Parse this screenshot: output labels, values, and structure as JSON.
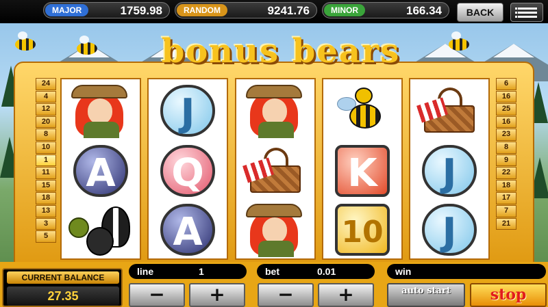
{
  "jackpots": {
    "major": {
      "label": "MAJOR",
      "value": "1759.98",
      "color": "#2f6fd6"
    },
    "random": {
      "label": "RANDOM",
      "value": "9241.76",
      "color": "#d8941a"
    },
    "minor": {
      "label": "MINOR",
      "value": "166.34",
      "color": "#3aa43a"
    }
  },
  "nav": {
    "back_label": "BACK",
    "menu_icon": "menu-icon"
  },
  "title": "bonus bears",
  "paylines": {
    "left": [
      "24",
      "4",
      "12",
      "20",
      "8",
      "10",
      "1",
      "11",
      "15",
      "18",
      "13",
      "3",
      "5"
    ],
    "right": [
      "6",
      "16",
      "25",
      "16",
      "23",
      "8",
      "9",
      "22",
      "18",
      "17",
      "7",
      "21"
    ]
  },
  "reels": [
    [
      "ranger",
      "A",
      "skunk"
    ],
    [
      "J",
      "Q",
      "A"
    ],
    [
      "ranger",
      "picnic-basket",
      "ranger"
    ],
    [
      "wasp",
      "K",
      "10"
    ],
    [
      "picnic-basket",
      "J",
      "J"
    ]
  ],
  "balance": {
    "label": "CURRENT BALANCE",
    "value": "27.35"
  },
  "line": {
    "label": "line",
    "value": "1"
  },
  "bet": {
    "label": "bet",
    "value": "0.01"
  },
  "win": {
    "label": "win",
    "value": ""
  },
  "buttons": {
    "minus": "−",
    "plus": "+",
    "auto_start": "auto start",
    "stop": "stop"
  }
}
